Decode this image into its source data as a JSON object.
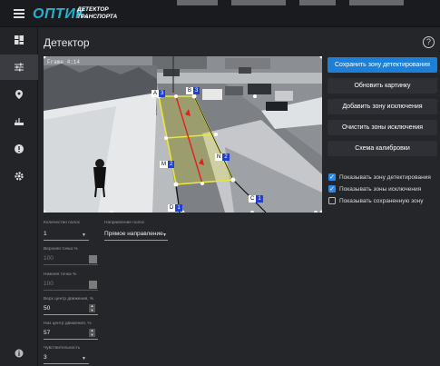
{
  "header": {
    "logo_main": "ОПТИК.",
    "logo_line1": "ДЕТЕКТОР",
    "logo_line2": "ТРАНСПОРТА"
  },
  "sidebar": {
    "items": [
      {
        "icon": "dashboard-icon",
        "active": false
      },
      {
        "icon": "sliders-icon",
        "active": true
      },
      {
        "icon": "location-pin-icon",
        "active": false
      },
      {
        "icon": "network-icon",
        "active": false
      },
      {
        "icon": "alert-icon",
        "active": false
      },
      {
        "icon": "gear-icon",
        "active": false
      }
    ],
    "bottom_icon": "info-icon"
  },
  "page": {
    "title": "Детектор",
    "help_glyph": "?"
  },
  "camera": {
    "overlay_text": "Frame 4:14",
    "markers": [
      "A",
      "B",
      "M",
      "N",
      "D",
      "C"
    ],
    "marker_numbers": [
      "3",
      "3",
      "2",
      "2",
      "1",
      "1"
    ]
  },
  "actions": {
    "save_zone": "Сохранить зону детектирования",
    "refresh_image": "Обновить картинку",
    "add_exclusion": "Добавить зону исключения",
    "clear_exclusions": "Очистить зоны исключения",
    "calibration": "Схема калибровки"
  },
  "checkboxes": [
    {
      "label": "Показывать зону детектирования",
      "checked": true
    },
    {
      "label": "Показывать зоны исключения",
      "checked": true
    },
    {
      "label": "Показывать сохраненную зону",
      "checked": false
    }
  ],
  "settings": {
    "lanes_label": "Количество полос",
    "lanes_value": "1",
    "direction_label": "Направление полос",
    "direction_value": "Прямое направление",
    "top_point_label": "Верхняя точка %",
    "top_point_value": "100",
    "bottom_point_label": "Нижняя точка %",
    "bottom_point_value": "100",
    "top_center_label": "Верх центр движения, %",
    "top_center_value": "50",
    "bottom_center_label": "Низ центр движения, %",
    "bottom_center_value": "57",
    "sensitivity_label": "Чувствительность",
    "sensitivity_value": "3"
  },
  "colors": {
    "accent": "#1e7fd8",
    "logo": "#1fb3cf",
    "zone_yellow": "#e8e83a",
    "direction_red": "#e02020"
  }
}
